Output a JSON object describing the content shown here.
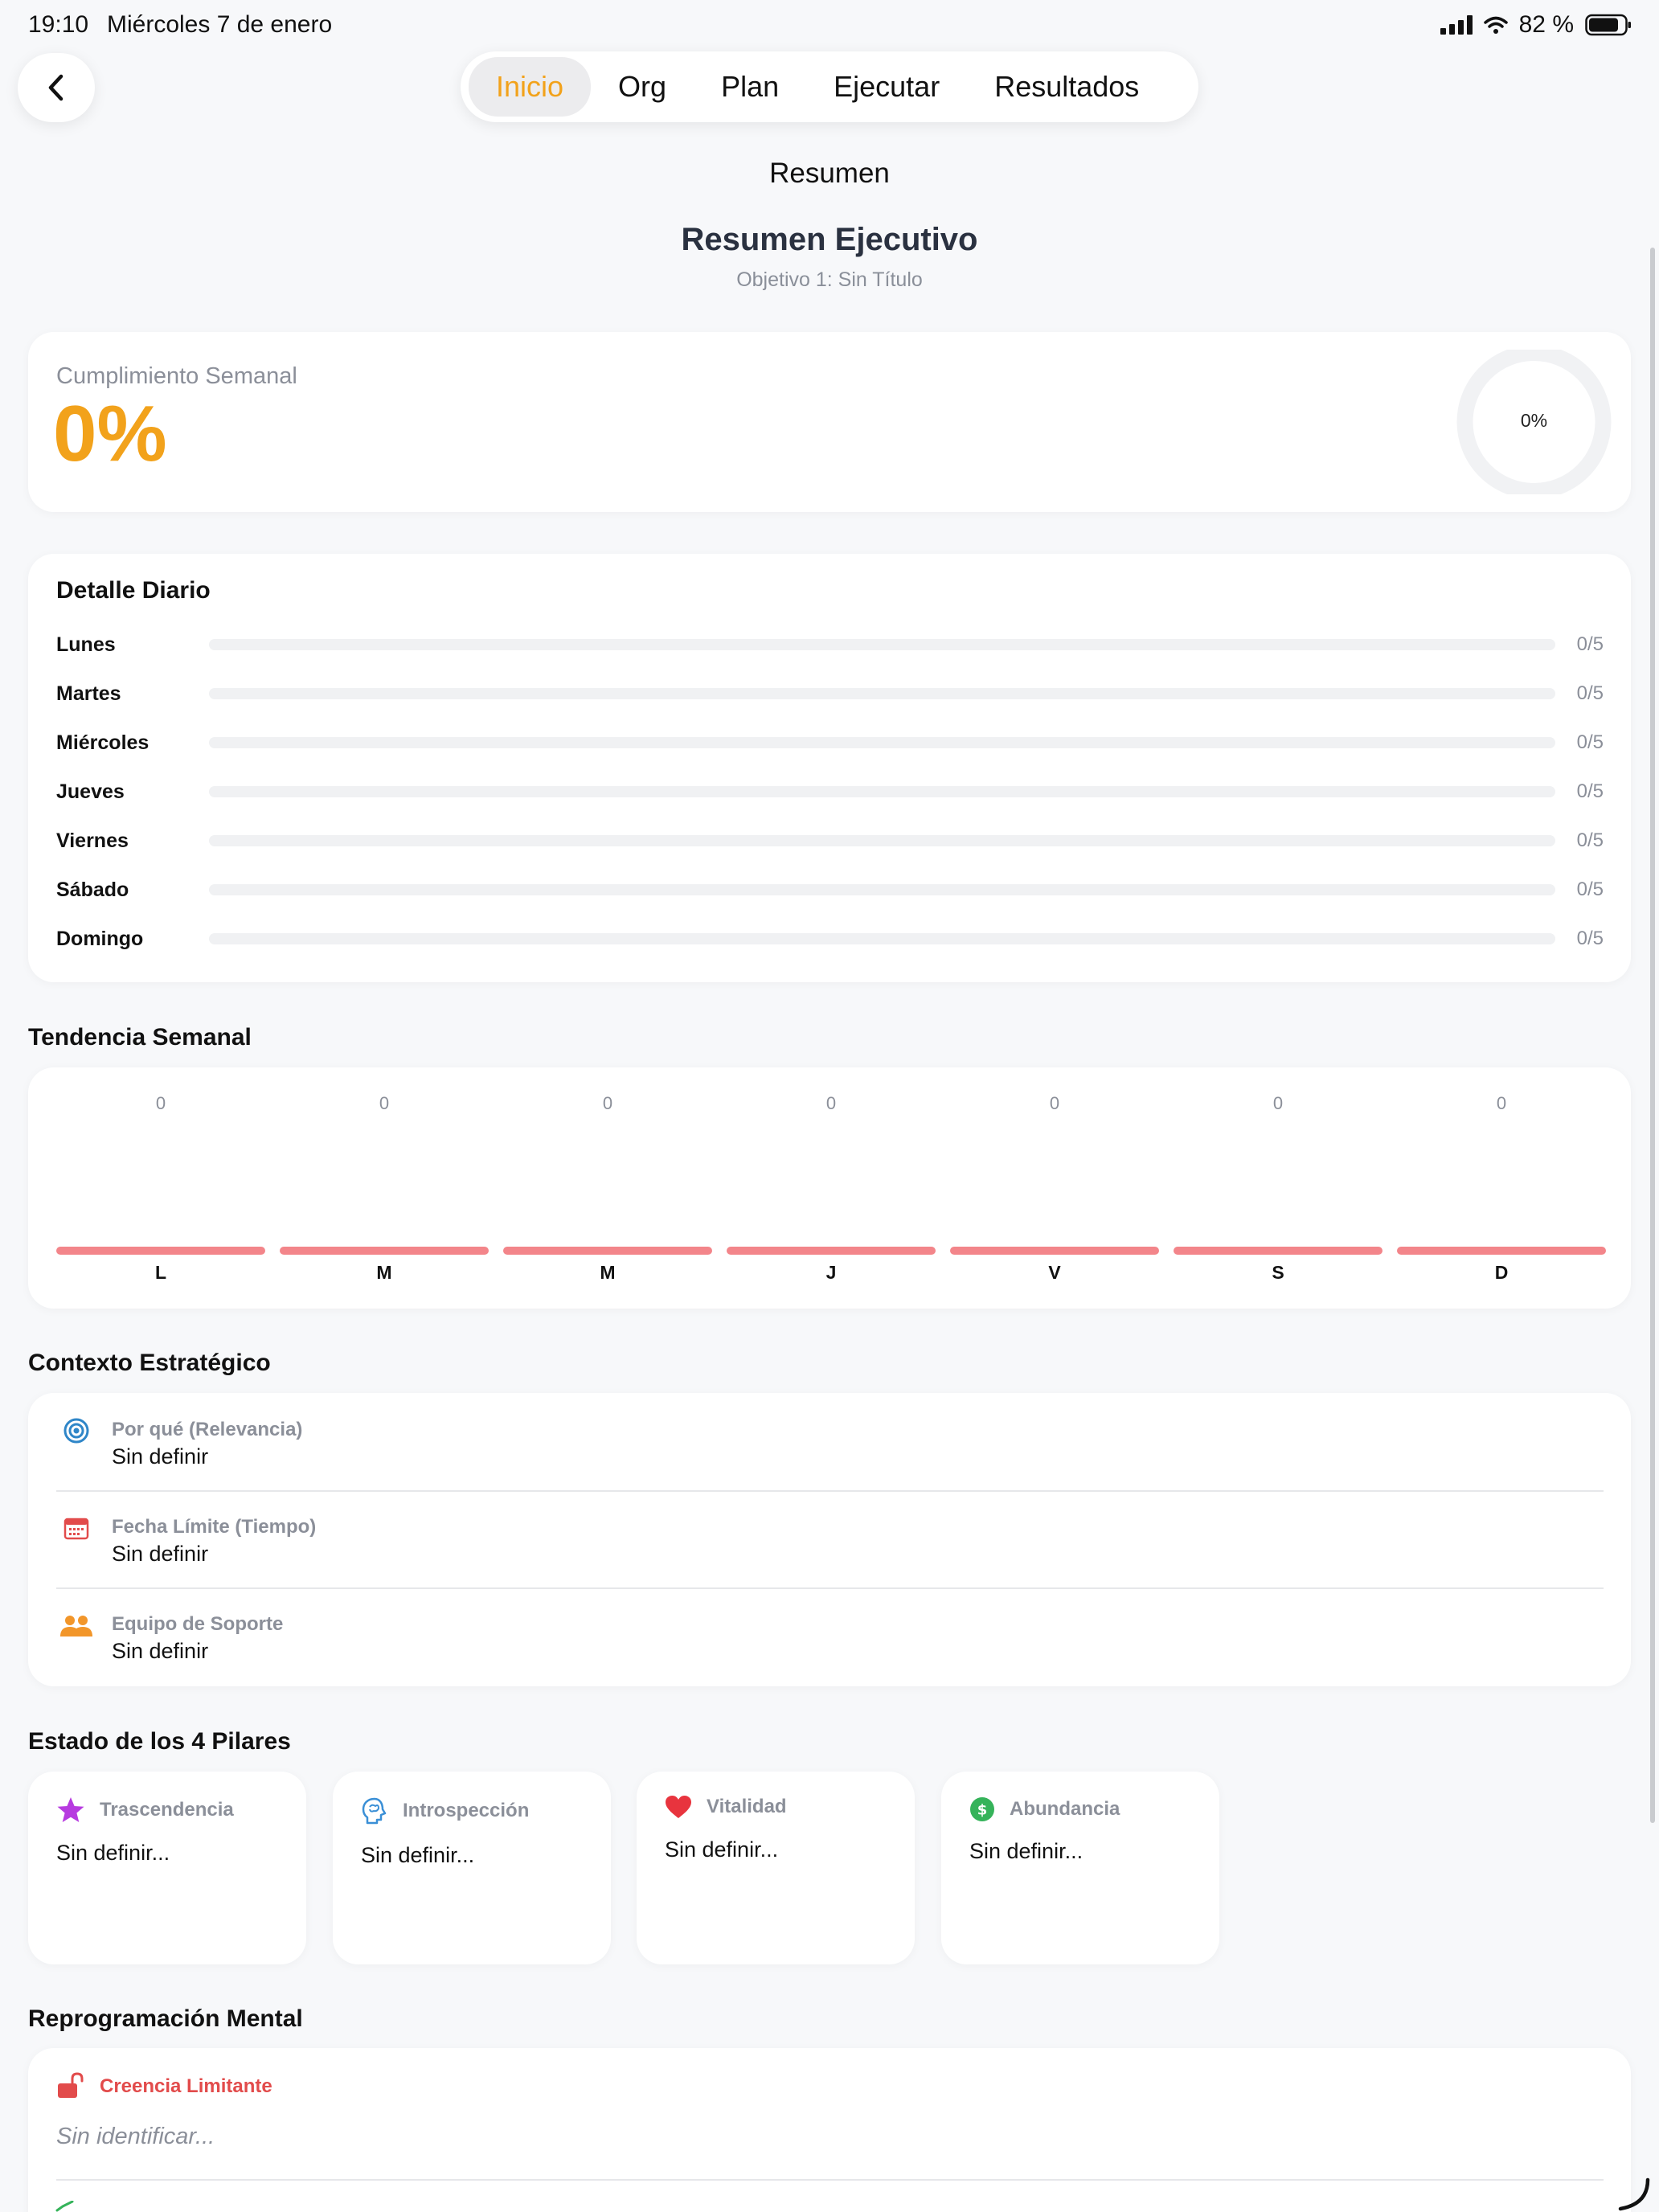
{
  "status_bar": {
    "time": "19:10",
    "date": "Miércoles 7 de enero",
    "battery": "82 %"
  },
  "nav": {
    "tabs": [
      {
        "label": "Inicio",
        "active": true
      },
      {
        "label": "Org",
        "active": false
      },
      {
        "label": "Plan",
        "active": false
      },
      {
        "label": "Ejecutar",
        "active": false
      },
      {
        "label": "Resultados",
        "active": false
      }
    ]
  },
  "page_title": "Resumen",
  "header": {
    "title": "Resumen Ejecutivo",
    "subtitle": "Objetivo 1: Sin Título"
  },
  "weekly": {
    "label": "Cumplimiento Semanal",
    "value": "0%",
    "ring_label": "0%",
    "ring_fraction": 0
  },
  "daily": {
    "title": "Detalle Diario",
    "days": [
      {
        "name": "Lunes",
        "count": "0/5",
        "fraction": 0
      },
      {
        "name": "Martes",
        "count": "0/5",
        "fraction": 0
      },
      {
        "name": "Miércoles",
        "count": "0/5",
        "fraction": 0
      },
      {
        "name": "Jueves",
        "count": "0/5",
        "fraction": 0
      },
      {
        "name": "Viernes",
        "count": "0/5",
        "fraction": 0
      },
      {
        "name": "Sábado",
        "count": "0/5",
        "fraction": 0
      },
      {
        "name": "Domingo",
        "count": "0/5",
        "fraction": 0
      }
    ]
  },
  "trend": {
    "title": "Tendencia Semanal",
    "bar_color": "#f3858a"
  },
  "chart_data": {
    "type": "bar",
    "categories": [
      "L",
      "M",
      "M",
      "J",
      "V",
      "S",
      "D"
    ],
    "values": [
      0,
      0,
      0,
      0,
      0,
      0,
      0
    ],
    "title": "Tendencia Semanal"
  },
  "context": {
    "title": "Contexto Estratégico",
    "items": [
      {
        "label": "Por qué (Relevancia)",
        "value": "Sin definir",
        "icon": "target-icon"
      },
      {
        "label": "Fecha Límite (Tiempo)",
        "value": "Sin definir",
        "icon": "calendar-icon"
      },
      {
        "label": "Equipo de Soporte",
        "value": "Sin definir",
        "icon": "people-icon"
      }
    ]
  },
  "pillars": {
    "title": "Estado de los 4 Pilares",
    "items": [
      {
        "label": "Trascendencia",
        "text": "Sin definir...",
        "icon": "star-icon",
        "color": "#b73be0"
      },
      {
        "label": "Introspección",
        "text": "Sin definir...",
        "icon": "brain-icon",
        "color": "#3a8fd6"
      },
      {
        "label": "Vitalidad",
        "text": "Sin definir...",
        "icon": "heart-icon",
        "color": "#e8343e"
      },
      {
        "label": "Abundancia",
        "text": "Sin definir...",
        "icon": "dollar-icon",
        "color": "#35b35a"
      }
    ]
  },
  "reprogramming": {
    "title": "Reprogramación Mental",
    "belief_label": "Creencia Limitante",
    "belief_placeholder": "Sin identificar..."
  },
  "colors": {
    "accent": "#f2a21b",
    "background": "#f7f8fa",
    "danger": "#e24b4b"
  }
}
